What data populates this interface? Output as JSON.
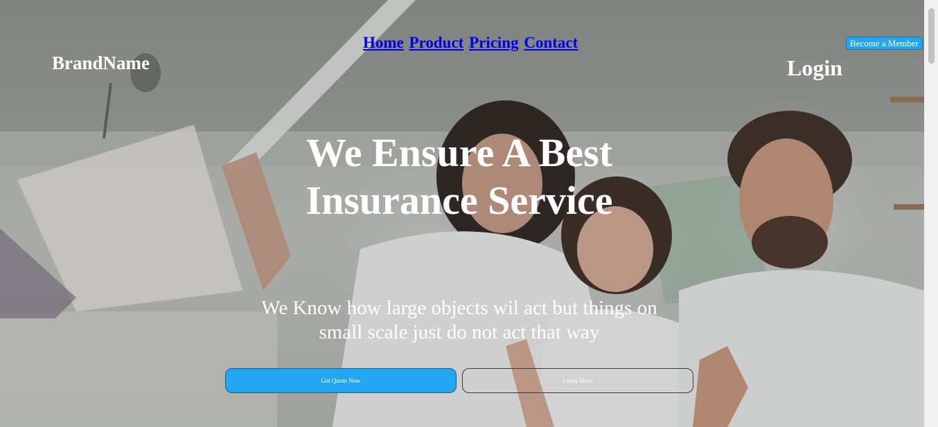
{
  "header": {
    "brand": "BrandName",
    "nav": [
      "Home",
      "Product",
      "Pricing",
      "Contact"
    ],
    "login": "Login",
    "member_button": "Become a Member"
  },
  "hero": {
    "headline_line1": "We Ensure A Best",
    "headline_line2": "Insurance Service",
    "subtitle_line1": "We Know how large objects wil act but things on",
    "subtitle_line2": "small scale just do not act that way",
    "primary_button": "Get Quote Now",
    "secondary_button": "Learn More"
  },
  "colors": {
    "accent": "#23a6f0",
    "nav_link": "#0000ee",
    "text_light": "#ffffff"
  }
}
